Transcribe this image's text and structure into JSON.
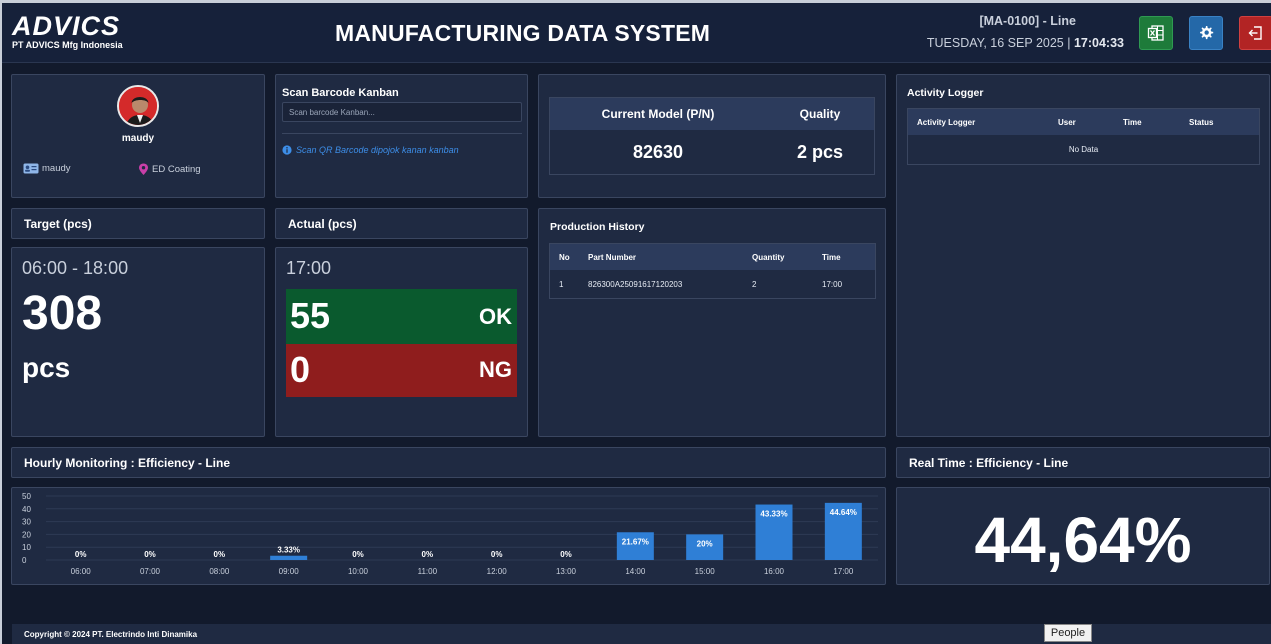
{
  "header": {
    "logo_text": "ADVICS",
    "logo_subtitle": "PT ADVICS Mfg Indonesia",
    "title": "MANUFACTURING DATA SYSTEM",
    "line_id": "[MA-0100] - Line",
    "date": "TUESDAY, 16 SEP 2025",
    "separator": " | ",
    "time": "17:04:33",
    "buttons": {
      "excel_icon": "excel-icon",
      "settings_icon": "gear-icon",
      "logout_icon": "logout-icon"
    }
  },
  "user": {
    "name": "maudy",
    "id_label": "maudy",
    "station": "ED Coating"
  },
  "scan": {
    "title": "Scan Barcode Kanban",
    "placeholder": "Scan barcode Kanban...",
    "hint": "Scan QR Barcode dipojok kanan kanban"
  },
  "current_model": {
    "col1": "Current Model (P/N)",
    "col2": "Quality",
    "model": "82630",
    "quality": "2 pcs"
  },
  "activity_logger": {
    "title": "Activity Logger",
    "columns": [
      "Activity Logger",
      "User",
      "Time",
      "Status"
    ],
    "empty": "No Data"
  },
  "target": {
    "label": "Target (pcs)",
    "shift": "06:00 - 18:00",
    "value": "308",
    "unit": "pcs"
  },
  "actual": {
    "label": "Actual (pcs)",
    "time": "17:00",
    "ok_value": "55",
    "ok_label": "OK",
    "ng_value": "0",
    "ng_label": "NG"
  },
  "production_history": {
    "title": "Production History",
    "columns": [
      "No",
      "Part Number",
      "Quantity",
      "Time"
    ],
    "rows": [
      [
        "1",
        "826300A25091617120203",
        "2",
        "17:00"
      ]
    ]
  },
  "hourly": {
    "label": "Hourly Monitoring : Efficiency - Line"
  },
  "realtime": {
    "label": "Real Time : Efficiency - Line",
    "value": "44,64%"
  },
  "chart_data": {
    "type": "bar",
    "categories": [
      "06:00",
      "07:00",
      "08:00",
      "09:00",
      "10:00",
      "11:00",
      "12:00",
      "13:00",
      "14:00",
      "15:00",
      "16:00",
      "17:00"
    ],
    "values": [
      0,
      0,
      0,
      3.33,
      0,
      0,
      0,
      0,
      21.67,
      20,
      43.33,
      44.64
    ],
    "data_labels": [
      "0%",
      "0%",
      "0%",
      "3.33%",
      "0%",
      "0%",
      "0%",
      "0%",
      "21.67%",
      "20%",
      "43.33%",
      "44.64%"
    ],
    "yticks": [
      0,
      10,
      20,
      30,
      40,
      50
    ],
    "ylim": [
      0,
      50
    ],
    "bar_color": "#2f7fd6",
    "grid": true,
    "legend": false
  },
  "footer": {
    "copyright": "Copyright © 2024 PT. Electrindo Inti Dinamika"
  },
  "tooltip": "People"
}
